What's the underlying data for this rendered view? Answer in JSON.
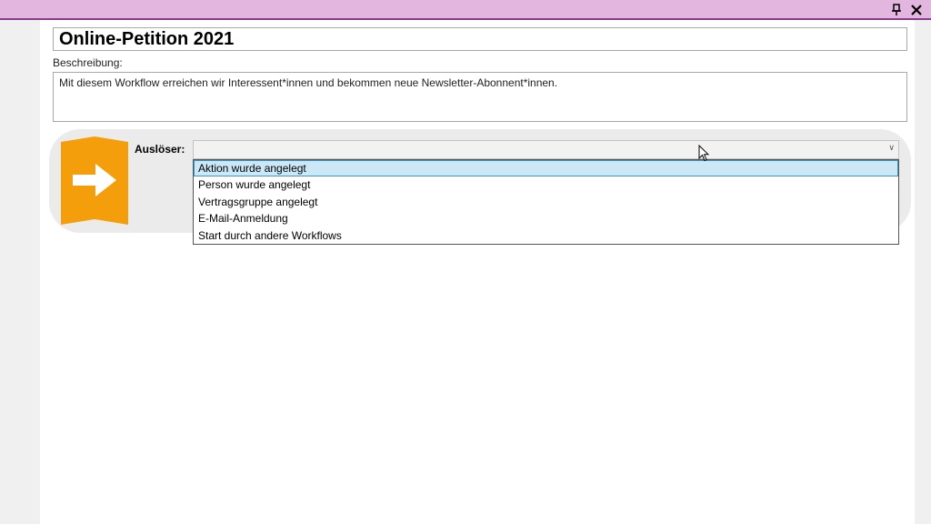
{
  "window": {
    "pin_icon": "pin-icon",
    "close_icon": "close-icon"
  },
  "form": {
    "title": "Online-Petition 2021",
    "description_label": "Beschreibung:",
    "description": "Mit diesem Workflow erreichen wir Interessent*innen und bekommen neue Newsletter-Abonnent*innen."
  },
  "trigger": {
    "icon": "arrow-right-icon",
    "icon_color": "#f59e0b",
    "label": "Auslöser:",
    "selected_value": "",
    "options": [
      "Aktion wurde angelegt",
      "Person wurde angelegt",
      "Vertragsgruppe angelegt",
      "E-Mail-Anmeldung",
      "Start durch andere Workflows"
    ],
    "highlighted_option": "Aktion wurde angelegt"
  },
  "colors": {
    "titlebar": "#e2b6de",
    "highlight": "#cce8f7",
    "accent": "#f59e0b"
  }
}
